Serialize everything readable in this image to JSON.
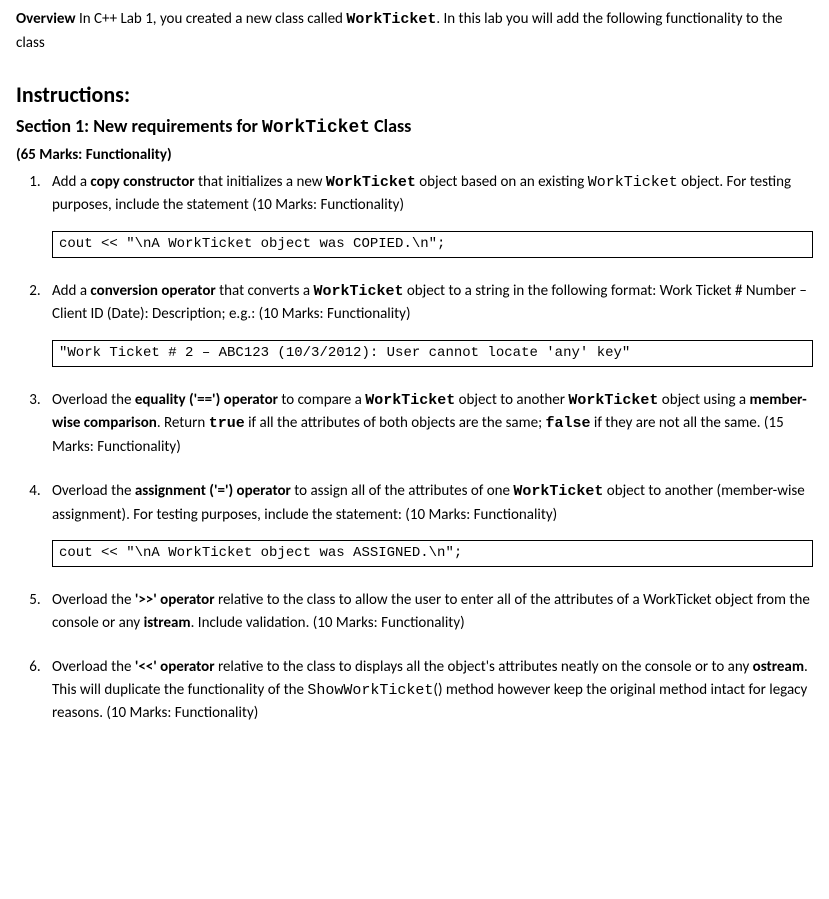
{
  "overview": {
    "label": "Overview",
    "text_pre": " In C++ Lab 1, you created a new class called ",
    "class_name": "WorkTicket",
    "text_post": ". In this lab you will add the following functionality to the class"
  },
  "instructions_heading": "Instructions:",
  "section1": {
    "prefix": "Section 1: New requirements for ",
    "class_name": "WorkTicket",
    "suffix": " Class",
    "marks": "(65 Marks: Functionality)"
  },
  "items": [
    {
      "parts": [
        {
          "t": "Add a "
        },
        {
          "t": "copy constructor",
          "b": true
        },
        {
          "t": " that initializes a new "
        },
        {
          "t": "WorkTicket",
          "m": true,
          "b": true
        },
        {
          "t": " object based on an existing "
        },
        {
          "t": "WorkTicket",
          "m": true
        },
        {
          "t": " object. For testing purposes, include the statement (10 Marks: Functionality)"
        }
      ],
      "code": "cout << \"\\nA WorkTicket object was COPIED.\\n\";"
    },
    {
      "parts": [
        {
          "t": "Add a "
        },
        {
          "t": "conversion operator",
          "b": true
        },
        {
          "t": " that converts a "
        },
        {
          "t": "WorkTicket",
          "m": true,
          "b": true
        },
        {
          "t": " object to a string in the following format: Work Ticket # Number – Client ID (Date): Description; e.g.: (10 Marks: Functionality)"
        }
      ],
      "code": "\"Work Ticket # 2 – ABC123 (10/3/2012): User cannot locate 'any' key\""
    },
    {
      "parts": [
        {
          "t": "Overload the "
        },
        {
          "t": "equality ('==') operator",
          "b": true
        },
        {
          "t": " to compare a "
        },
        {
          "t": "WorkTicket",
          "m": true,
          "b": true
        },
        {
          "t": " object to another "
        },
        {
          "t": "WorkTicket",
          "m": true,
          "b": true
        },
        {
          "t": " object using a "
        },
        {
          "t": "member-wise comparison",
          "b": true
        },
        {
          "t": ". Return "
        },
        {
          "t": "true",
          "m": true,
          "b": true
        },
        {
          "t": " if all the attributes of both objects are the same; "
        },
        {
          "t": "false",
          "m": true,
          "b": true
        },
        {
          "t": " if they are not all the same. (15 Marks: Functionality)"
        }
      ]
    },
    {
      "parts": [
        {
          "t": "Overload the "
        },
        {
          "t": "assignment ('=') operator",
          "b": true
        },
        {
          "t": " to assign all of the attributes of one "
        },
        {
          "t": "WorkTicket",
          "m": true,
          "b": true
        },
        {
          "t": " object to another (member-wise assignment).  For testing purposes, include the statement: (10 Marks: Functionality)"
        }
      ],
      "code": "cout << \"\\nA WorkTicket object was ASSIGNED.\\n\";"
    },
    {
      "parts": [
        {
          "t": "Overload the "
        },
        {
          "t": "'>>' operator",
          "b": true
        },
        {
          "t": " relative to the class to allow the user to enter all of the attributes of a WorkTicket object from the console or any "
        },
        {
          "t": "istream",
          "b": true
        },
        {
          "t": ". Include validation. (10 Marks: Functionality)"
        }
      ]
    },
    {
      "parts": [
        {
          "t": "Overload the "
        },
        {
          "t": "'<<' operator",
          "b": true
        },
        {
          "t": " relative to the class to displays all the object's attributes neatly on the console or to any "
        },
        {
          "t": "ostream",
          "b": true
        },
        {
          "t": ". This will duplicate the functionality of the "
        },
        {
          "t": "ShowWorkTicket",
          "m": true
        },
        {
          "t": "() method however keep the original method intact for legacy reasons. (10 Marks: Functionality)"
        }
      ]
    }
  ]
}
